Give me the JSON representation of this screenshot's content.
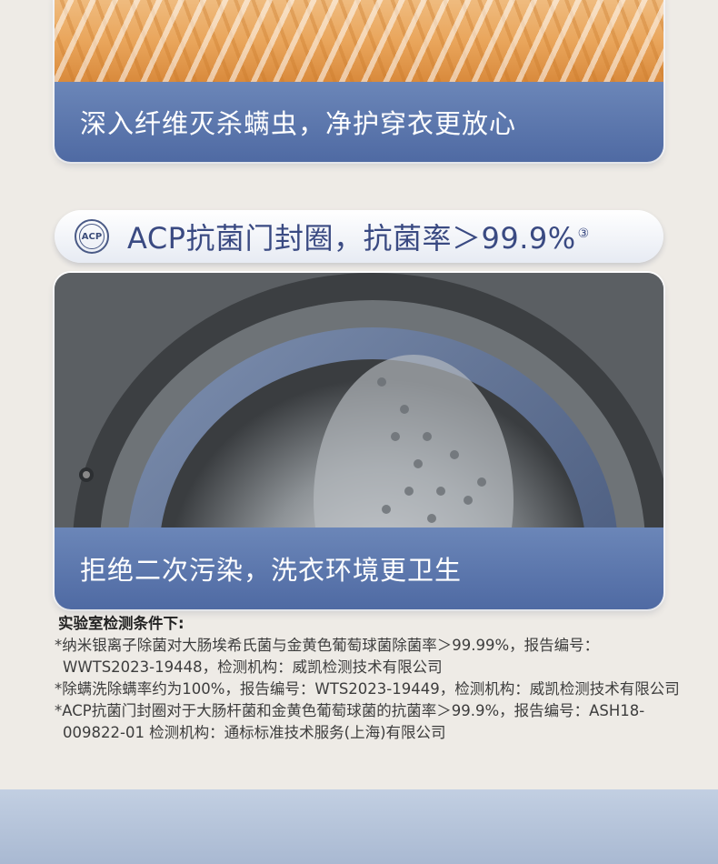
{
  "section1": {
    "photo_icon": "fiber-closeup-image",
    "caption": "深入纤维灭杀螨虫，净护穿衣更放心"
  },
  "section2": {
    "badge_icon": "acp-badge-icon",
    "badge_text": "ACP",
    "title": "ACP抗菌门封圈，抗菌率＞99.9%",
    "title_sup": "③",
    "photo_icon": "washer-door-seal-image",
    "caption": "拒绝二次污染，洗衣环境更卫生"
  },
  "footnotes": {
    "heading": "实验室检测条件下:",
    "items": [
      "*纳米银离子除菌对大肠埃希氏菌与金黄色葡萄球菌除菌率＞99.99%，报告编号：WWTS2023-19448，检测机构：威凯检测技术有限公司",
      "*除螨洗除螨率约为100%，报告编号：WTS2023-19449，检测机构：威凯检测技术有限公司",
      "*ACP抗菌门封圈对于大肠杆菌和金黄色葡萄球菌的抗菌率＞99.9%，报告编号：ASH18-009822-01 检测机构：通标标准技术服务(上海)有限公司"
    ]
  },
  "colors": {
    "banner": "#5a76ad",
    "title": "#3a4a82",
    "background": "#eeebe6"
  }
}
